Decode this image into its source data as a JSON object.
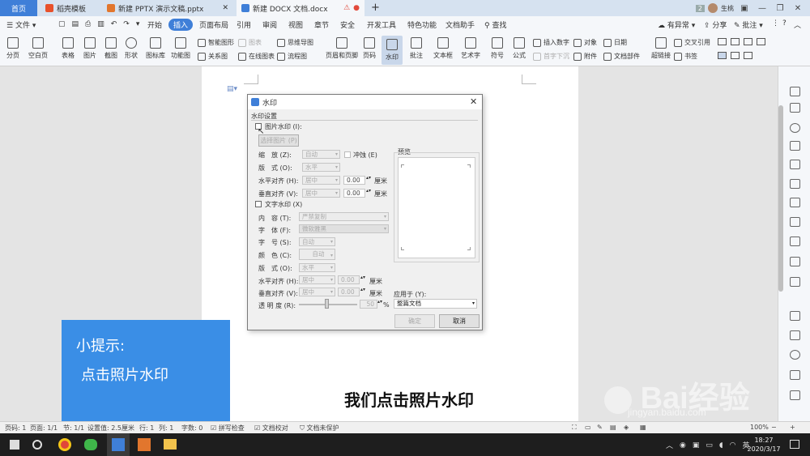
{
  "tabs": [
    {
      "label": "首页"
    },
    {
      "label": "稻壳模板"
    },
    {
      "label": "新建 PPTX 演示文稿.pptx"
    },
    {
      "label": "新建 DOCX 文档.docx"
    }
  ],
  "tab_add": "+",
  "window": {
    "badge": "2",
    "user": "生桃"
  },
  "menu": {
    "file": "文件",
    "items": [
      "开始",
      "插入",
      "页面布局",
      "引用",
      "审阅",
      "视图",
      "章节",
      "安全",
      "开发工具",
      "特色功能",
      "文档助手"
    ],
    "active": "插入",
    "search": "查找",
    "right": [
      "有异常",
      "分享",
      "批注"
    ]
  },
  "ribbon": {
    "big": [
      "分页",
      "空白页",
      "表格",
      "图片",
      "截图",
      "形状",
      "图标库",
      "功能图",
      "页眉和页脚",
      "页码",
      "水印",
      "批注",
      "文本框",
      "艺术字",
      "符号",
      "公式",
      "超链接"
    ],
    "small": [
      "智能图形",
      "图表",
      "关系图",
      "在线图表",
      "思维导图",
      "流程图",
      "插入数字",
      "对象",
      "日期",
      "首字下沉",
      "附件",
      "文档部件",
      "交叉引用",
      "书签"
    ]
  },
  "dialog": {
    "title": "水印",
    "section": "水印设置",
    "picture_wm": "图片水印 (I):",
    "select_pic": "选择图片 (P)",
    "scale_label": "缩　放 (Z):",
    "scale_value": "自动",
    "washout": "冲蚀 (E)",
    "layout_label": "版　式 (O):",
    "layout_value": "水平",
    "halign_label": "水平对齐 (H):",
    "halign_value": "居中",
    "valign_label": "垂直对齐 (V):",
    "valign_value": "居中",
    "num": "0.00",
    "unit": "厘米",
    "preview": "预览",
    "text_wm": "文字水印 (X)",
    "content_label": "内　容 (T):",
    "content_value": "严禁复制",
    "font_label": "字　体 (F):",
    "font_value": "微软雅黑",
    "size_label": "字　号 (S):",
    "size_value": "自动",
    "color_label": "颜　色 (C):",
    "color_value": "自动",
    "layout2_label": "版　式 (O):",
    "layout2_value": "水平",
    "halign2_label": "水平对齐 (H):",
    "halign2_value": "居中",
    "valign2_label": "垂直对齐 (V):",
    "valign2_value": "居中",
    "opacity_label": "透 明 度 (R):",
    "opacity_value": "50",
    "opacity_unit": "%",
    "apply_label": "应用于 (Y):",
    "apply_value": "整篇文档",
    "ok": "确定",
    "cancel": "取消"
  },
  "hint": {
    "title": "小提示:",
    "body": "点击照片水印"
  },
  "caption": "我们点击照片水印",
  "watermark": {
    "main": "Bai经验",
    "sub": "jingyan.baidu.com"
  },
  "status": {
    "items": [
      "页码: 1",
      "页面: 1/1",
      "节: 1/1",
      "设置值: 2.5厘米",
      "行: 1",
      "列: 1",
      "字数: 0",
      "拼写检查",
      "文档校对",
      "文档未保护"
    ],
    "zoom": "100%"
  },
  "taskbar": {
    "lang": "英",
    "time": "18:27",
    "date": "2020/3/17"
  },
  "colors": {
    "accent": "#3f7fd8",
    "hint_bg": "#3a8ee6",
    "tabbar": "#d6e2f0"
  }
}
